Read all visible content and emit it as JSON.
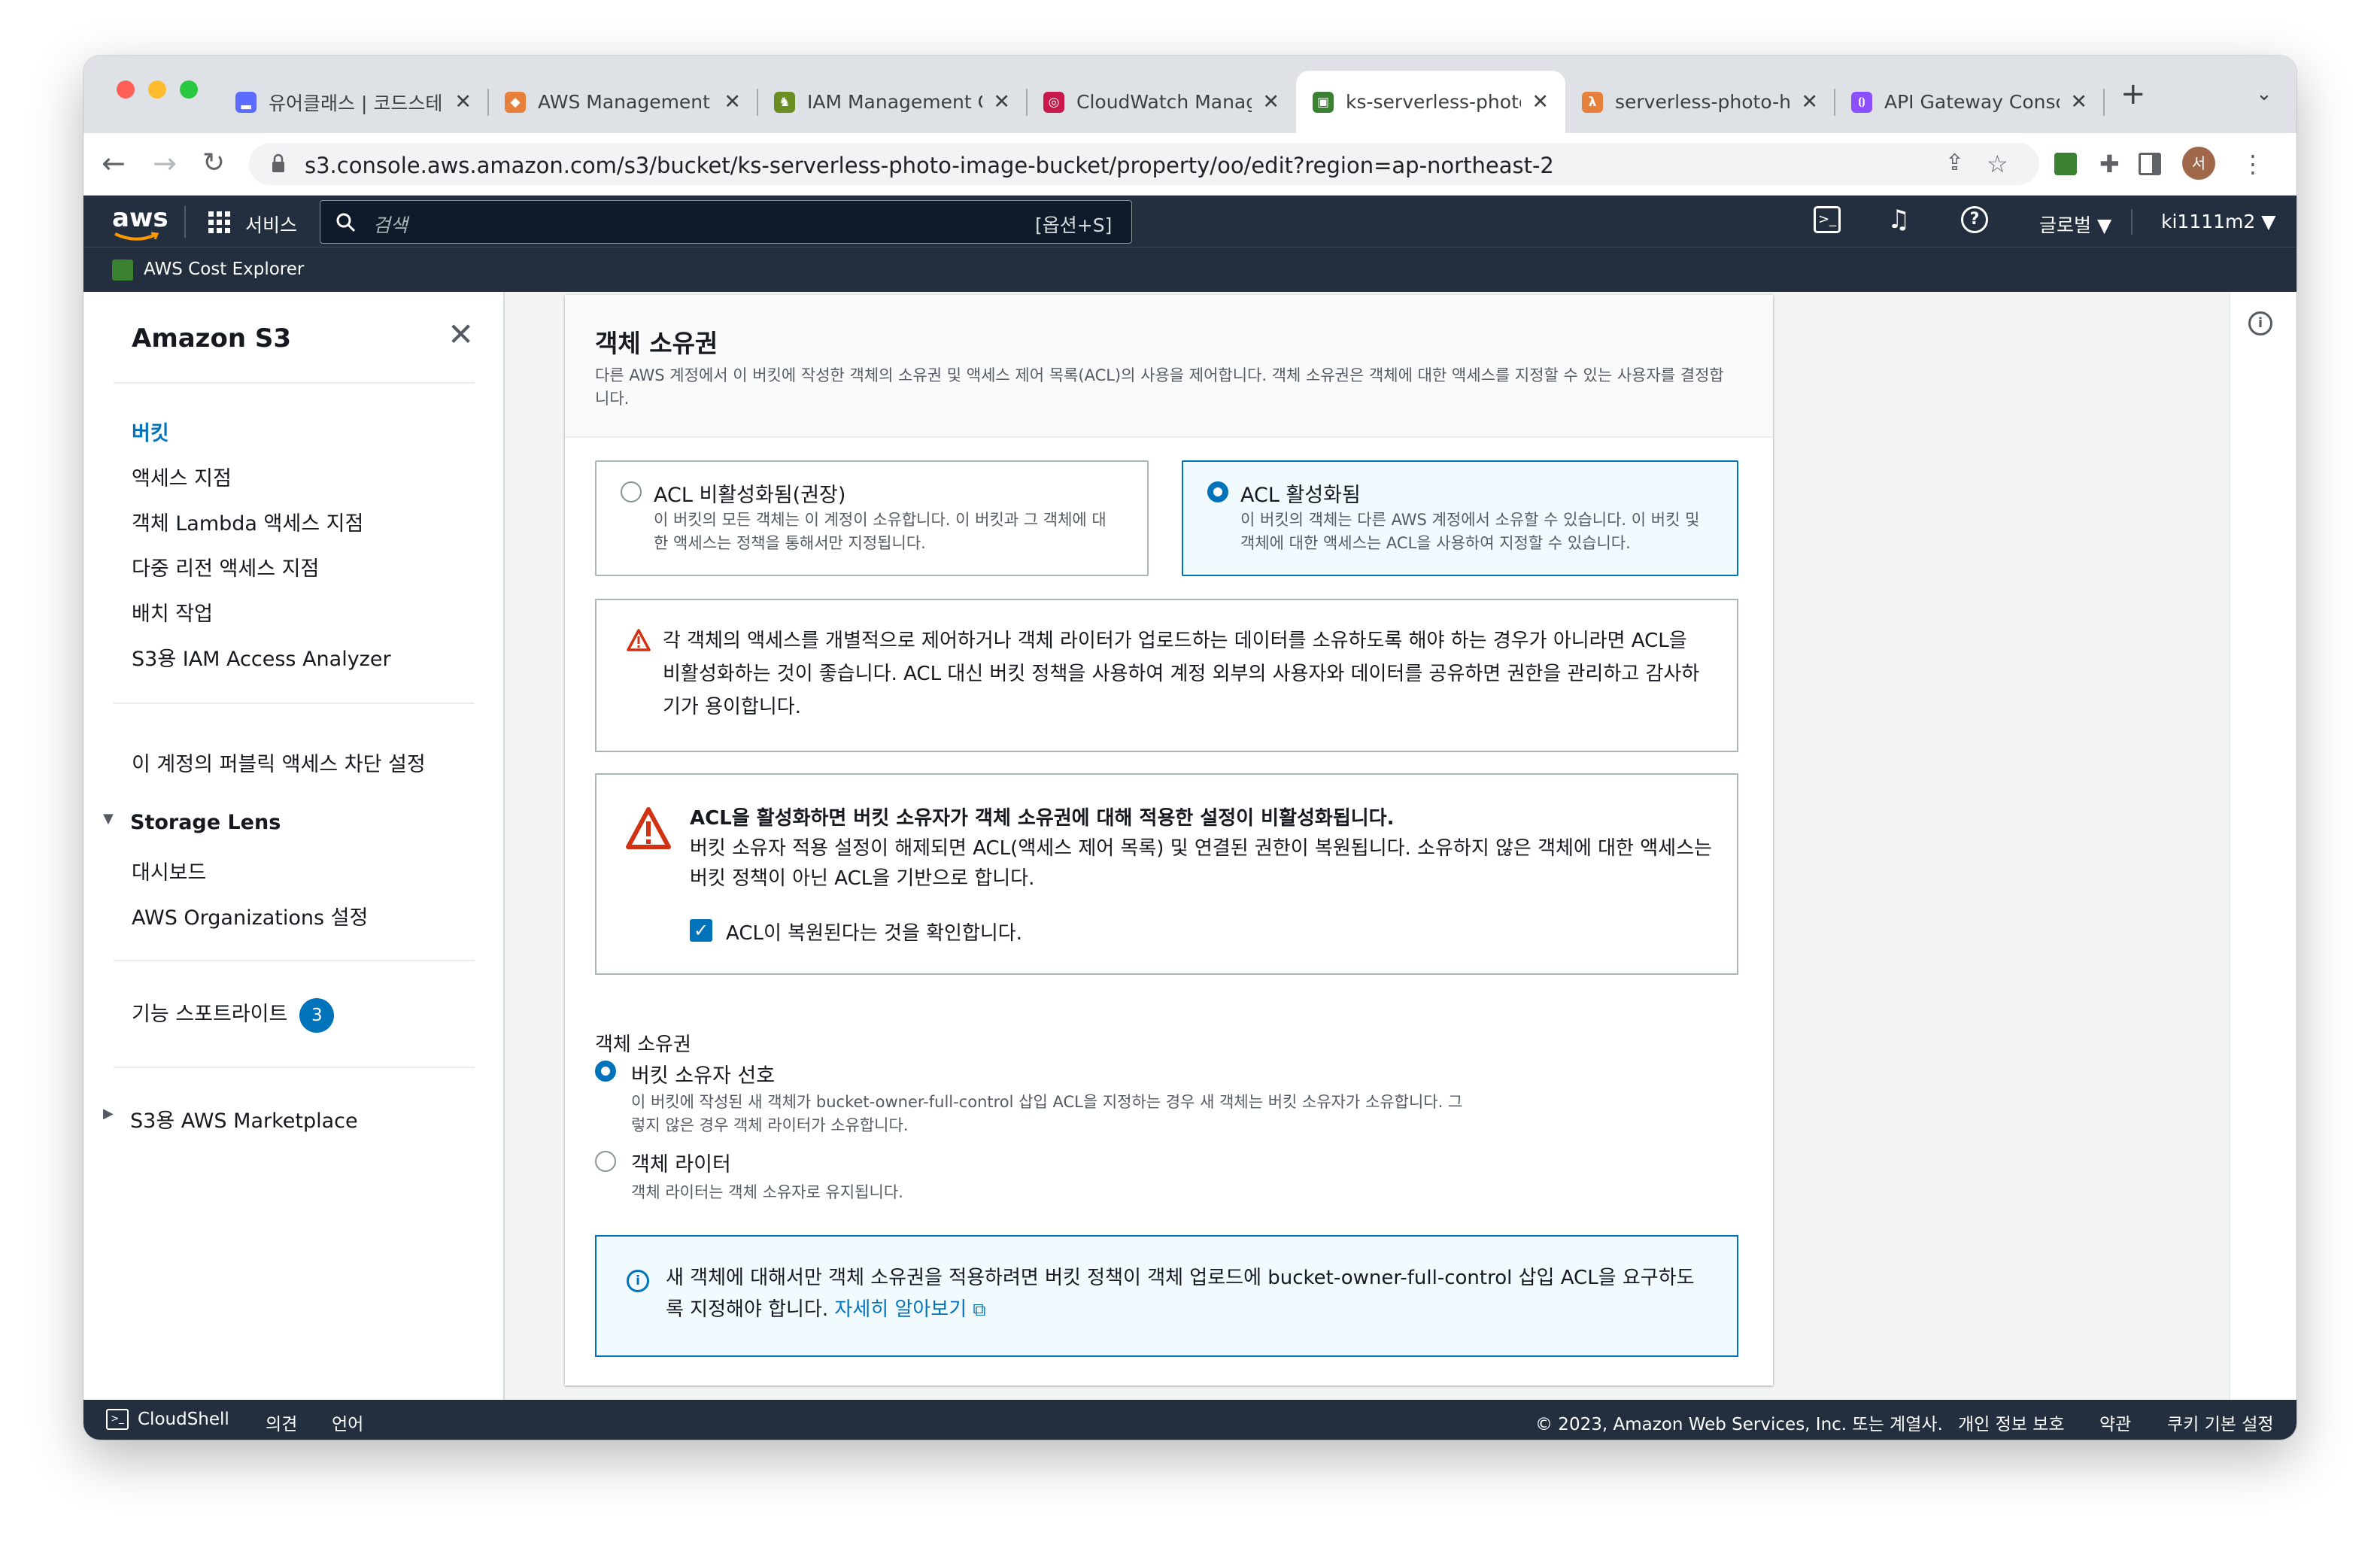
{
  "browser": {
    "tabs": [
      {
        "title": "유어클래스 | 코드스테이",
        "fav_color": "#5b6cff",
        "fav_glyph": "▂"
      },
      {
        "title": "AWS Management C",
        "fav_color": "#e7803a",
        "fav_glyph": "◆"
      },
      {
        "title": "IAM Management Co",
        "fav_color": "#6b8e23",
        "fav_glyph": "♞"
      },
      {
        "title": "CloudWatch Manage",
        "fav_color": "#c9184a",
        "fav_glyph": "◎"
      },
      {
        "title": "ks-serverless-photo",
        "fav_color": "#3b8132",
        "fav_glyph": "▣"
      },
      {
        "title": "serverless-photo-he",
        "fav_color": "#e7803a",
        "fav_glyph": "λ"
      },
      {
        "title": "API Gateway Consol",
        "fav_color": "#8c4fff",
        "fav_glyph": "⦗⦘"
      }
    ],
    "close_glyph": "✕",
    "newtab_glyph": "+",
    "tabmenu_glyph": "⌄",
    "url": "s3.console.aws.amazon.com/s3/bucket/ks-serverless-photo-image-bucket/property/oo/edit?region=ap-northeast-2",
    "profile_initial": "서"
  },
  "aws_nav": {
    "logo": "aws",
    "services": "서비스",
    "search_placeholder": "검색",
    "search_shortcut": "[옵션+S]",
    "region": "글로벌 ▼",
    "account": "ki1111m2 ▼",
    "bookmark": "AWS Cost Explorer"
  },
  "sidebar": {
    "title": "Amazon S3",
    "items": [
      "버킷",
      "액세스 지점",
      "객체 Lambda 액세스 지점",
      "다중 리전 액세스 지점",
      "배치 작업",
      "S3용 IAM Access Analyzer"
    ],
    "block_public": "이 계정의 퍼블릭 액세스 차단 설정",
    "storage_lens": "Storage Lens",
    "storage_lens_items": [
      "대시보드",
      "AWS Organizations 설정"
    ],
    "spotlight": "기능 스포트라이트",
    "spotlight_count": "3",
    "marketplace": "S3용 AWS Marketplace"
  },
  "panel": {
    "title": "객체 소유권",
    "description": "다른 AWS 계정에서 이 버킷에 작성한 객체의 소유권 및 액세스 제어 목록(ACL)의 사용을 제어합니다. 객체 소유권은 객체에 대한 액세스를 지정할 수 있는 사용자를 결정합니다.",
    "acl_disabled": {
      "label": "ACL 비활성화됨(권장)",
      "desc": "이 버킷의 모든 객체는 이 계정이 소유합니다. 이 버킷과 그 객체에 대한 액세스는 정책을 통해서만 지정됩니다."
    },
    "acl_enabled": {
      "label": "ACL 활성화됨",
      "desc": "이 버킷의 객체는 다른 AWS 계정에서 소유할 수 있습니다. 이 버킷 및 객체에 대한 액세스는 ACL을 사용하여 지정할 수 있습니다."
    },
    "warning_text": "각 객체의 액세스를 개별적으로 제어하거나 객체 라이터가 업로드하는 데이터를 소유하도록 해야 하는 경우가 아니라면 ACL을 비활성화하는 것이 좋습니다. ACL 대신 버킷 정책을 사용하여 계정 외부의 사용자와 데이터를 공유하면 권한을 관리하고 감사하기가 용이합니다.",
    "critical_title": "ACL을 활성화하면 버킷 소유자가 객체 소유권에 대해 적용한 설정이 비활성화됩니다.",
    "critical_text": "버킷 소유자 적용 설정이 해제되면 ACL(액세스 제어 목록) 및 연결된 권한이 복원됩니다. 소유하지 않은 객체에 대한 액세스는 버킷 정책이 아닌 ACL을 기반으로 합니다.",
    "confirm_label": "ACL이 복원된다는 것을 확인합니다.",
    "ownership_label": "객체 소유권",
    "opt_bucket_owner": {
      "label": "버킷 소유자 선호",
      "desc": "이 버킷에 작성된 새 객체가 bucket-owner-full-control 삽입 ACL을 지정하는 경우 새 객체는 버킷 소유자가 소유합니다. 그렇지 않은 경우 객체 라이터가 소유합니다."
    },
    "opt_object_writer": {
      "label": "객체 라이터",
      "desc": "객체 라이터는 객체 소유자로 유지됩니다."
    },
    "info_text": "새 객체에 대해서만 객체 소유권을 적용하려면 버킷 정책이 객체 업로드에 bucket-owner-full-control 삽입 ACL을 요구하도록 지정해야 합니다.",
    "info_link": "자세히 알아보기"
  },
  "footer": {
    "cloudshell": "CloudShell",
    "feedback": "의견",
    "language": "언어",
    "copyright": "© 2023, Amazon Web Services, Inc. 또는 계열사.",
    "privacy": "개인 정보 보호",
    "terms": "약관",
    "cookies": "쿠키 기본 설정"
  },
  "colors": {
    "aws_nav": "#232f3e",
    "accent": "#0073bb",
    "aws_orange": "#ff9900",
    "warning": "#d13212"
  }
}
